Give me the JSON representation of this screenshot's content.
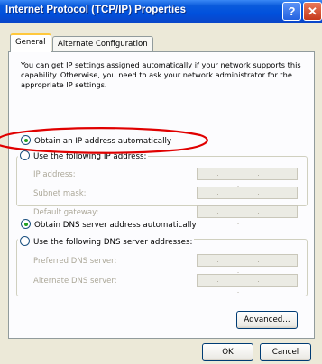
{
  "window": {
    "title": "Internet Protocol (TCP/IP) Properties",
    "help_label": "?",
    "close_label": "✕"
  },
  "tabs": [
    {
      "label": "General",
      "active": true
    },
    {
      "label": "Alternate Configuration",
      "active": false
    }
  ],
  "description": "You can get IP settings assigned automatically if your network supports this capability. Otherwise, you need to ask your network administrator for the appropriate IP settings.",
  "ip_options": {
    "auto_label": "Obtain an IP address automatically",
    "manual_label": "Use the following IP address:",
    "selected": "auto"
  },
  "ip_fields": [
    {
      "label": "IP address:",
      "value": ". . ."
    },
    {
      "label": "Subnet mask:",
      "value": ". . ."
    },
    {
      "label": "Default gateway:",
      "value": ". . ."
    }
  ],
  "dns_options": {
    "auto_label": "Obtain DNS server address automatically",
    "manual_label": "Use the following DNS server addresses:",
    "selected": "auto"
  },
  "dns_fields": [
    {
      "label": "Preferred DNS server:",
      "value": ". . ."
    },
    {
      "label": "Alternate DNS server:",
      "value": ". . ."
    }
  ],
  "buttons": {
    "advanced": "Advanced...",
    "ok": "OK",
    "cancel": "Cancel"
  },
  "colors": {
    "titlebar": "#0050DC",
    "dialog_bg": "#ECE9D8",
    "annotation": "#E00000"
  }
}
